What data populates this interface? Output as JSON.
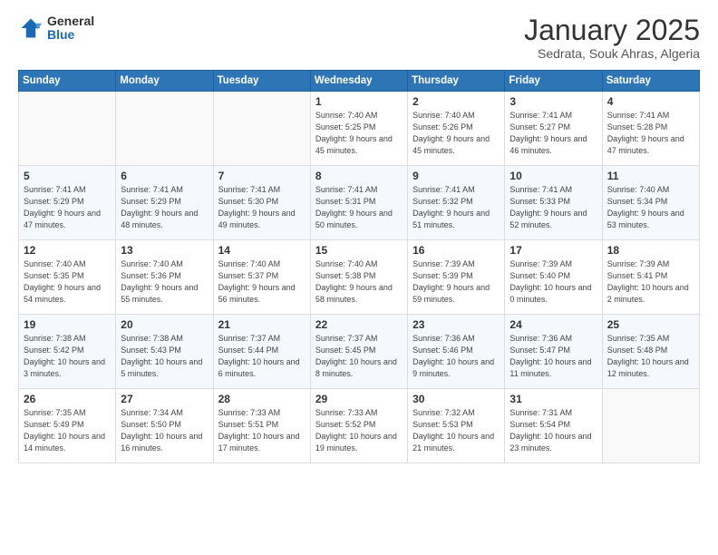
{
  "logo": {
    "general": "General",
    "blue": "Blue"
  },
  "header": {
    "title": "January 2025",
    "subtitle": "Sedrata, Souk Ahras, Algeria"
  },
  "weekdays": [
    "Sunday",
    "Monday",
    "Tuesday",
    "Wednesday",
    "Thursday",
    "Friday",
    "Saturday"
  ],
  "weeks": [
    [
      {
        "day": "",
        "info": ""
      },
      {
        "day": "",
        "info": ""
      },
      {
        "day": "",
        "info": ""
      },
      {
        "day": "1",
        "info": "Sunrise: 7:40 AM\nSunset: 5:25 PM\nDaylight: 9 hours and 45 minutes."
      },
      {
        "day": "2",
        "info": "Sunrise: 7:40 AM\nSunset: 5:26 PM\nDaylight: 9 hours and 45 minutes."
      },
      {
        "day": "3",
        "info": "Sunrise: 7:41 AM\nSunset: 5:27 PM\nDaylight: 9 hours and 46 minutes."
      },
      {
        "day": "4",
        "info": "Sunrise: 7:41 AM\nSunset: 5:28 PM\nDaylight: 9 hours and 47 minutes."
      }
    ],
    [
      {
        "day": "5",
        "info": "Sunrise: 7:41 AM\nSunset: 5:29 PM\nDaylight: 9 hours and 47 minutes."
      },
      {
        "day": "6",
        "info": "Sunrise: 7:41 AM\nSunset: 5:29 PM\nDaylight: 9 hours and 48 minutes."
      },
      {
        "day": "7",
        "info": "Sunrise: 7:41 AM\nSunset: 5:30 PM\nDaylight: 9 hours and 49 minutes."
      },
      {
        "day": "8",
        "info": "Sunrise: 7:41 AM\nSunset: 5:31 PM\nDaylight: 9 hours and 50 minutes."
      },
      {
        "day": "9",
        "info": "Sunrise: 7:41 AM\nSunset: 5:32 PM\nDaylight: 9 hours and 51 minutes."
      },
      {
        "day": "10",
        "info": "Sunrise: 7:41 AM\nSunset: 5:33 PM\nDaylight: 9 hours and 52 minutes."
      },
      {
        "day": "11",
        "info": "Sunrise: 7:40 AM\nSunset: 5:34 PM\nDaylight: 9 hours and 53 minutes."
      }
    ],
    [
      {
        "day": "12",
        "info": "Sunrise: 7:40 AM\nSunset: 5:35 PM\nDaylight: 9 hours and 54 minutes."
      },
      {
        "day": "13",
        "info": "Sunrise: 7:40 AM\nSunset: 5:36 PM\nDaylight: 9 hours and 55 minutes."
      },
      {
        "day": "14",
        "info": "Sunrise: 7:40 AM\nSunset: 5:37 PM\nDaylight: 9 hours and 56 minutes."
      },
      {
        "day": "15",
        "info": "Sunrise: 7:40 AM\nSunset: 5:38 PM\nDaylight: 9 hours and 58 minutes."
      },
      {
        "day": "16",
        "info": "Sunrise: 7:39 AM\nSunset: 5:39 PM\nDaylight: 9 hours and 59 minutes."
      },
      {
        "day": "17",
        "info": "Sunrise: 7:39 AM\nSunset: 5:40 PM\nDaylight: 10 hours and 0 minutes."
      },
      {
        "day": "18",
        "info": "Sunrise: 7:39 AM\nSunset: 5:41 PM\nDaylight: 10 hours and 2 minutes."
      }
    ],
    [
      {
        "day": "19",
        "info": "Sunrise: 7:38 AM\nSunset: 5:42 PM\nDaylight: 10 hours and 3 minutes."
      },
      {
        "day": "20",
        "info": "Sunrise: 7:38 AM\nSunset: 5:43 PM\nDaylight: 10 hours and 5 minutes."
      },
      {
        "day": "21",
        "info": "Sunrise: 7:37 AM\nSunset: 5:44 PM\nDaylight: 10 hours and 6 minutes."
      },
      {
        "day": "22",
        "info": "Sunrise: 7:37 AM\nSunset: 5:45 PM\nDaylight: 10 hours and 8 minutes."
      },
      {
        "day": "23",
        "info": "Sunrise: 7:36 AM\nSunset: 5:46 PM\nDaylight: 10 hours and 9 minutes."
      },
      {
        "day": "24",
        "info": "Sunrise: 7:36 AM\nSunset: 5:47 PM\nDaylight: 10 hours and 11 minutes."
      },
      {
        "day": "25",
        "info": "Sunrise: 7:35 AM\nSunset: 5:48 PM\nDaylight: 10 hours and 12 minutes."
      }
    ],
    [
      {
        "day": "26",
        "info": "Sunrise: 7:35 AM\nSunset: 5:49 PM\nDaylight: 10 hours and 14 minutes."
      },
      {
        "day": "27",
        "info": "Sunrise: 7:34 AM\nSunset: 5:50 PM\nDaylight: 10 hours and 16 minutes."
      },
      {
        "day": "28",
        "info": "Sunrise: 7:33 AM\nSunset: 5:51 PM\nDaylight: 10 hours and 17 minutes."
      },
      {
        "day": "29",
        "info": "Sunrise: 7:33 AM\nSunset: 5:52 PM\nDaylight: 10 hours and 19 minutes."
      },
      {
        "day": "30",
        "info": "Sunrise: 7:32 AM\nSunset: 5:53 PM\nDaylight: 10 hours and 21 minutes."
      },
      {
        "day": "31",
        "info": "Sunrise: 7:31 AM\nSunset: 5:54 PM\nDaylight: 10 hours and 23 minutes."
      },
      {
        "day": "",
        "info": ""
      }
    ]
  ]
}
